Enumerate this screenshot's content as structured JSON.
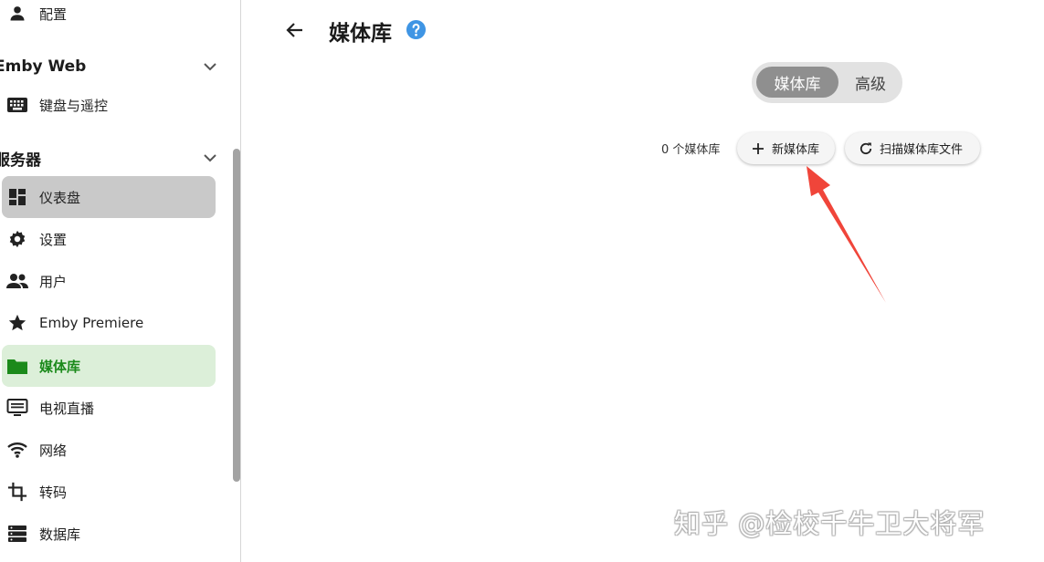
{
  "sidebar": {
    "top_item": {
      "label": "配置",
      "icon": "person-icon"
    },
    "section_emby_web": {
      "title": "Emby Web",
      "items": [
        {
          "label": "键盘与遥控",
          "icon": "keyboard-icon"
        }
      ]
    },
    "section_server": {
      "title": "服务器",
      "items": [
        {
          "label": "仪表盘",
          "icon": "dashboard-icon",
          "state": "selected"
        },
        {
          "label": "设置",
          "icon": "gear-icon"
        },
        {
          "label": "用户",
          "icon": "users-icon"
        },
        {
          "label": "Emby Premiere",
          "icon": "star-icon"
        },
        {
          "label": "媒体库",
          "icon": "folder-icon",
          "state": "active"
        },
        {
          "label": "电视直播",
          "icon": "tv-icon"
        },
        {
          "label": "网络",
          "icon": "wifi-icon"
        },
        {
          "label": "转码",
          "icon": "crop-icon"
        },
        {
          "label": "数据库",
          "icon": "database-icon"
        }
      ]
    }
  },
  "header": {
    "title": "媒体库",
    "back_icon": "back-arrow-icon",
    "help_icon": "help-icon"
  },
  "tabs": {
    "items": [
      "媒体库",
      "高级"
    ],
    "selected": "媒体库"
  },
  "toolbar": {
    "library_count": "0 个媒体库",
    "new_library_label": "新媒体库",
    "scan_label": "扫描媒体库文件"
  },
  "annotation": {
    "color": "#f0453a"
  },
  "watermark": "知乎 @检校千牛卫大将军",
  "colors": {
    "accent_green": "#1b8a1b",
    "active_bg": "#dcefd9",
    "help_blue": "#3f95e4"
  }
}
